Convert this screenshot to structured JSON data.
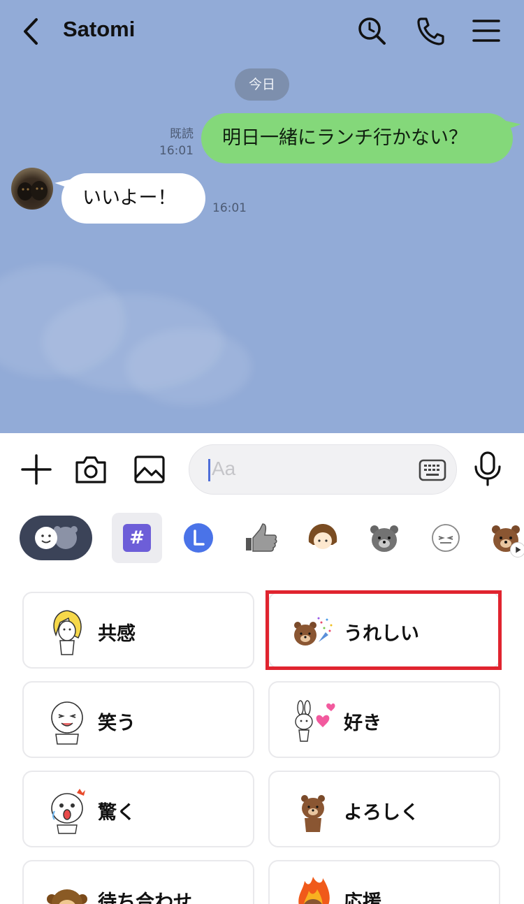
{
  "header": {
    "title": "Satomi",
    "icons": [
      "back-icon",
      "search-icon",
      "phone-icon",
      "menu-icon"
    ]
  },
  "chat": {
    "date_label": "今日",
    "messages": [
      {
        "direction": "out",
        "text": "明日一緒にランチ行かない？",
        "status": "既読",
        "time": "16:01"
      },
      {
        "direction": "in",
        "text": "いいよー！",
        "time": "16:01"
      }
    ]
  },
  "input": {
    "placeholder": "Aa",
    "tools": [
      "plus-icon",
      "camera-icon",
      "image-icon",
      "keyboard-icon",
      "mic-icon"
    ]
  },
  "sticker_tabs": [
    "emoji-tab",
    "hashtag-tab",
    "line-l-tab",
    "thumbs-up-tab",
    "girl-tab",
    "bear-gray-tab",
    "face-lines-tab",
    "brown-bear-tab"
  ],
  "categories": [
    {
      "label": "共感",
      "sticker": "blonde-girl"
    },
    {
      "label": "うれしい",
      "sticker": "brown-celebrate",
      "highlighted": true
    },
    {
      "label": "笑う",
      "sticker": "moon-laugh"
    },
    {
      "label": "好き",
      "sticker": "cony-hearts"
    },
    {
      "label": "驚く",
      "sticker": "moon-shock"
    },
    {
      "label": "よろしく",
      "sticker": "brown-bow"
    },
    {
      "label": "待ち合わせ",
      "sticker": "monkey"
    },
    {
      "label": "応援",
      "sticker": "brown-fire"
    }
  ],
  "colors": {
    "chat_bg": "#92abd7",
    "outgoing_bubble": "#84d87a",
    "highlight": "#e0242f",
    "hashtag": "#6d5ed8"
  }
}
